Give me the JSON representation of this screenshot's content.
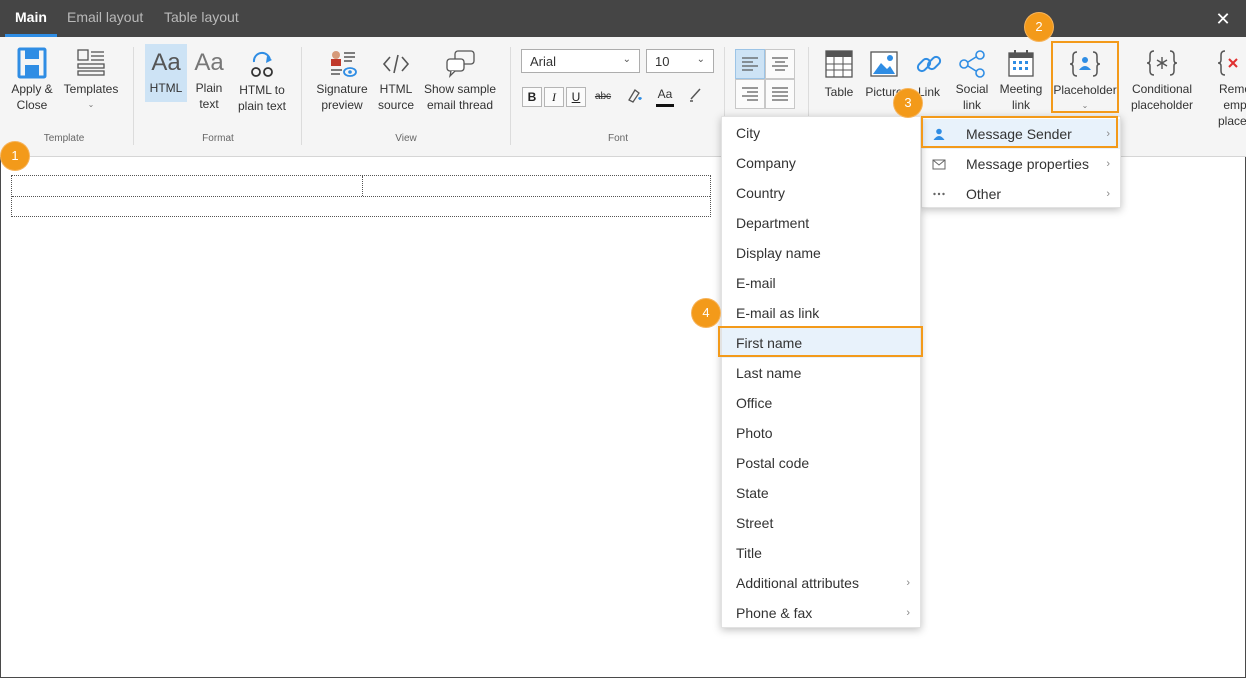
{
  "tabs": [
    {
      "label": "Main",
      "active": true
    },
    {
      "label": "Email layout",
      "active": false
    },
    {
      "label": "Table layout",
      "active": false
    }
  ],
  "close_icon": "close-icon",
  "ribbon": {
    "template": {
      "group_label": "Template",
      "apply_close": "Apply &\nClose",
      "templates": "Templates"
    },
    "format": {
      "group_label": "Format",
      "html": "HTML",
      "plain_text": "Plain\ntext",
      "html_to_plain": "HTML to\nplain text"
    },
    "view": {
      "group_label": "View",
      "signature_preview": "Signature\npreview",
      "html_source": "HTML\nsource",
      "show_thread": "Show sample\nemail thread"
    },
    "font": {
      "group_label": "Font",
      "family": "Arial",
      "size": "10",
      "bold": "B",
      "italic": "I",
      "underline": "U",
      "strike": "abc",
      "color": "Aa"
    },
    "insert": {
      "table": "Table",
      "picture": "Picture",
      "link": "Link",
      "social_link": "Social\nlink",
      "meeting_link": "Meeting\nlink",
      "placeholder": "Placeholder",
      "conditional_placeholder": "Conditional\nplaceholder",
      "remove_empty": "Remo\nemp\nplaceh"
    }
  },
  "callouts": [
    "1",
    "2",
    "3",
    "4"
  ],
  "placeholder_menu": [
    {
      "label": "Message Sender",
      "icon": "person-icon",
      "has_submenu": true,
      "highlighted": true
    },
    {
      "label": "Message properties",
      "icon": "envelope-icon",
      "has_submenu": true
    },
    {
      "label": "Other",
      "icon": "ellipsis-icon",
      "has_submenu": true
    }
  ],
  "sender_menu": [
    {
      "label": "City"
    },
    {
      "label": "Company"
    },
    {
      "label": "Country"
    },
    {
      "label": "Department"
    },
    {
      "label": "Display name"
    },
    {
      "label": "E-mail"
    },
    {
      "label": "E-mail as link"
    },
    {
      "label": "First name",
      "highlighted": true
    },
    {
      "label": "Last name"
    },
    {
      "label": "Office"
    },
    {
      "label": "Photo"
    },
    {
      "label": "Postal code"
    },
    {
      "label": "State"
    },
    {
      "label": "Street"
    },
    {
      "label": "Title"
    },
    {
      "label": "Additional attributes",
      "has_submenu": true
    },
    {
      "label": "Phone & fax",
      "has_submenu": true
    }
  ],
  "colors": {
    "accent": "#2f8de4",
    "callout": "#f39a1a",
    "highlight_bg": "#e8f2fb"
  }
}
